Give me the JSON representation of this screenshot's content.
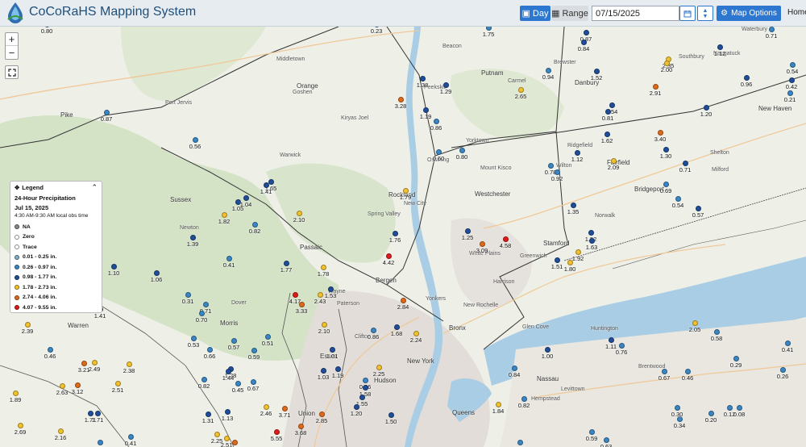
{
  "header": {
    "title": "CoCoRaHS Mapping System",
    "day_label": "Day",
    "range_label": "Range",
    "date_value": "07/15/2025",
    "map_options_label": "Map Options",
    "home_label": "Home"
  },
  "legend": {
    "heading": "Legend",
    "title": "24-Hour Precipitation",
    "date": "Jul 15, 2025",
    "obs_time": "4:30 AM-9:30 AM local obs time",
    "items": [
      {
        "label": "NA",
        "color": "#888888"
      },
      {
        "label": "Zero",
        "color": "#ffffff"
      },
      {
        "label": "Trace",
        "color": "#ffffff"
      },
      {
        "label": "0.01 - 0.25 in.",
        "color": "#7fb0c8"
      },
      {
        "label": "0.26 - 0.97 in.",
        "color": "#3b86c4"
      },
      {
        "label": "0.98 - 1.77 in.",
        "color": "#1f4e9a"
      },
      {
        "label": "1.78 - 2.73 in.",
        "color": "#f2c12e"
      },
      {
        "label": "2.74 - 4.06 in.",
        "color": "#e06a1b"
      },
      {
        "label": "4.07 - 9.55 in.",
        "color": "#e01a1a"
      }
    ]
  },
  "places": [
    {
      "n": "Middletown"
    },
    {
      "n": "Orange"
    },
    {
      "n": "Goshen"
    },
    {
      "n": "Kiryas Joel"
    },
    {
      "n": "Warwick"
    },
    {
      "n": "Sussex"
    },
    {
      "n": "Pike"
    },
    {
      "n": "Port Jervis"
    },
    {
      "n": "Rockland"
    },
    {
      "n": "New City"
    },
    {
      "n": "Spring Valley"
    },
    {
      "n": "Westchester"
    },
    {
      "n": "White Plains"
    },
    {
      "n": "New Rochelle"
    },
    {
      "n": "Yonkers"
    },
    {
      "n": "Bronx"
    },
    {
      "n": "New York"
    },
    {
      "n": "Bergen"
    },
    {
      "n": "Paterson"
    },
    {
      "n": "Passaic"
    },
    {
      "n": "Morris"
    },
    {
      "n": "Essex"
    },
    {
      "n": "Hudson"
    },
    {
      "n": "Warren"
    },
    {
      "n": "Union"
    },
    {
      "n": "Nassau"
    },
    {
      "n": "Queens"
    },
    {
      "n": "Putnam"
    },
    {
      "n": "Danbury"
    },
    {
      "n": "Fairfield"
    },
    {
      "n": "Bridgeport"
    },
    {
      "n": "Stamford"
    },
    {
      "n": "Norwalk"
    },
    {
      "n": "New Haven"
    },
    {
      "n": "Milford"
    },
    {
      "n": "Huntington"
    },
    {
      "n": "Brentwood"
    },
    {
      "n": "Hempstead"
    },
    {
      "n": "Levittown"
    },
    {
      "n": "Yorktown"
    },
    {
      "n": "Peekskill"
    },
    {
      "n": "Greenwich"
    },
    {
      "n": "Harrison"
    },
    {
      "n": "Glen Cove"
    },
    {
      "n": "Newburgh"
    },
    {
      "n": "Beacon"
    },
    {
      "n": "Carmel"
    },
    {
      "n": "Brewster"
    },
    {
      "n": "Ridgefield"
    },
    {
      "n": "Wilton"
    },
    {
      "n": "Mount Kisco"
    },
    {
      "n": "Clifton"
    },
    {
      "n": "Wayne"
    },
    {
      "n": "Dover"
    },
    {
      "n": "Newton"
    },
    {
      "n": "Shelton"
    },
    {
      "n": "Naugatuck"
    },
    {
      "n": "Waterbury"
    },
    {
      "n": "Southbury"
    },
    {
      "n": "Ossining"
    }
  ],
  "stations": [
    {
      "v": "0.80",
      "c": 4
    },
    {
      "v": "0.23",
      "c": 4
    },
    {
      "v": "1.75",
      "c": 4
    },
    {
      "v": "0.87",
      "c": 5
    },
    {
      "v": "0.84",
      "c": 5
    },
    {
      "v": "0.71",
      "c": 4
    },
    {
      "v": "1.12",
      "c": 5
    },
    {
      "v": "2.35",
      "c": 6
    },
    {
      "v": "2.00",
      "c": 6
    },
    {
      "v": "0.96",
      "c": 5
    },
    {
      "v": "0.54",
      "c": 4
    },
    {
      "v": "0.42",
      "c": 5
    },
    {
      "v": "0.21",
      "c": 4
    },
    {
      "v": "0.94",
      "c": 4
    },
    {
      "v": "1.52",
      "c": 5
    },
    {
      "v": "1.38",
      "c": 5
    },
    {
      "v": "1.29",
      "c": 5
    },
    {
      "v": "2.65",
      "c": 6
    },
    {
      "v": "2.91",
      "c": 7
    },
    {
      "v": "3.28",
      "c": 7
    },
    {
      "v": "1.19",
      "c": 5
    },
    {
      "v": "0.86",
      "c": 4
    },
    {
      "v": "0.87",
      "c": 4
    },
    {
      "v": "1.54",
      "c": 5
    },
    {
      "v": "0.81",
      "c": 5
    },
    {
      "v": "1.20",
      "c": 5
    },
    {
      "v": "1.62",
      "c": 5
    },
    {
      "v": "3.40",
      "c": 7
    },
    {
      "v": "1.30",
      "c": 5
    },
    {
      "v": "0.71",
      "c": 5
    },
    {
      "v": "0.56",
      "c": 4
    },
    {
      "v": "0.60",
      "c": 4
    },
    {
      "v": "0.80",
      "c": 4
    },
    {
      "v": "1.12",
      "c": 5
    },
    {
      "v": "2.09",
      "c": 6
    },
    {
      "v": "0.78",
      "c": 4
    },
    {
      "v": "0.92",
      "c": 4
    },
    {
      "v": "0.69",
      "c": 4
    },
    {
      "v": "0.54",
      "c": 4
    },
    {
      "v": "0.57",
      "c": 5
    },
    {
      "v": "1.65",
      "c": 5
    },
    {
      "v": "1.41",
      "c": 5
    },
    {
      "v": "1.79",
      "c": 6
    },
    {
      "v": "1.35",
      "c": 5
    },
    {
      "v": "1.05",
      "c": 5
    },
    {
      "v": "1.04",
      "c": 5
    },
    {
      "v": "2.10",
      "c": 6
    },
    {
      "v": "1.82",
      "c": 6
    },
    {
      "v": "0.82",
      "c": 4
    },
    {
      "v": "1.39",
      "c": 5
    },
    {
      "v": "1.76",
      "c": 5
    },
    {
      "v": "1.25",
      "c": 5
    },
    {
      "v": "4.58",
      "c": 8
    },
    {
      "v": "3.09",
      "c": 7
    },
    {
      "v": "1.52",
      "c": 5
    },
    {
      "v": "1.63",
      "c": 5
    },
    {
      "v": "1.92",
      "c": 6
    },
    {
      "v": "1.51",
      "c": 5
    },
    {
      "v": "1.80",
      "c": 6
    },
    {
      "v": "0.41",
      "c": 4
    },
    {
      "v": "1.77",
      "c": 5
    },
    {
      "v": "4.42",
      "c": 8
    },
    {
      "v": "1.78",
      "c": 6
    },
    {
      "v": "1.10",
      "c": 5
    },
    {
      "v": "1.06",
      "c": 5
    },
    {
      "v": "1.53",
      "c": 5
    },
    {
      "v": "0.31",
      "c": 4
    },
    {
      "v": "0.71",
      "c": 4
    },
    {
      "v": "4.17",
      "c": 8
    },
    {
      "v": "3.33",
      "c": 7
    },
    {
      "v": "2.43",
      "c": 6
    },
    {
      "v": "2.84",
      "c": 7
    },
    {
      "v": "1.41",
      "c": 5
    },
    {
      "v": "0.70",
      "c": 4
    },
    {
      "v": "2.39",
      "c": 6
    },
    {
      "v": "2.10",
      "c": 6
    },
    {
      "v": "0.86",
      "c": 4
    },
    {
      "v": "1.68",
      "c": 5
    },
    {
      "v": "2.24",
      "c": 6
    },
    {
      "v": "2.05",
      "c": 6
    },
    {
      "v": "0.58",
      "c": 4
    },
    {
      "v": "0.53",
      "c": 4
    },
    {
      "v": "0.57",
      "c": 4
    },
    {
      "v": "0.51",
      "c": 4
    },
    {
      "v": "0.66",
      "c": 4
    },
    {
      "v": "0.59",
      "c": 4
    },
    {
      "v": "1.01",
      "c": 5
    },
    {
      "v": "0.46",
      "c": 4
    },
    {
      "v": "1.11",
      "c": 5
    },
    {
      "v": "0.76",
      "c": 4
    },
    {
      "v": "1.00",
      "c": 5
    },
    {
      "v": "0.29",
      "c": 4
    },
    {
      "v": "0.41",
      "c": 4
    },
    {
      "v": "3.21",
      "c": 7
    },
    {
      "v": "2.49",
      "c": 6
    },
    {
      "v": "2.38",
      "c": 6
    },
    {
      "v": "1.28",
      "c": 5
    },
    {
      "v": "1.03",
      "c": 5
    },
    {
      "v": "1.19",
      "c": 5
    },
    {
      "v": "2.25",
      "c": 6
    },
    {
      "v": "0.84",
      "c": 4
    },
    {
      "v": "0.67",
      "c": 4
    },
    {
      "v": "0.46",
      "c": 4
    },
    {
      "v": "0.26",
      "c": 4
    },
    {
      "v": "2.63",
      "c": 6
    },
    {
      "v": "3.12",
      "c": 7
    },
    {
      "v": "2.51",
      "c": 6
    },
    {
      "v": "0.82",
      "c": 4
    },
    {
      "v": "1.44",
      "c": 5
    },
    {
      "v": "0.45",
      "c": 4
    },
    {
      "v": "0.67",
      "c": 4
    },
    {
      "v": "0.86",
      "c": 4
    },
    {
      "v": "1.58",
      "c": 5
    },
    {
      "v": "1.55",
      "c": 5
    },
    {
      "v": "0.82",
      "c": 4
    },
    {
      "v": "1.89",
      "c": 6
    },
    {
      "v": "1.71",
      "c": 5
    },
    {
      "v": "1.71",
      "c": 5
    },
    {
      "v": "1.31",
      "c": 5
    },
    {
      "v": "1.13",
      "c": 5
    },
    {
      "v": "2.46",
      "c": 6
    },
    {
      "v": "3.71",
      "c": 7
    },
    {
      "v": "2.85",
      "c": 7
    },
    {
      "v": "1.20",
      "c": 5
    },
    {
      "v": "1.50",
      "c": 5
    },
    {
      "v": "1.84",
      "c": 6
    },
    {
      "v": "0.34",
      "c": 4
    },
    {
      "v": "0.30",
      "c": 4
    },
    {
      "v": "0.20",
      "c": 4
    },
    {
      "v": "0.12",
      "c": 4
    },
    {
      "v": "0.08",
      "c": 4
    },
    {
      "v": "2.69",
      "c": 6
    },
    {
      "v": "2.16",
      "c": 6
    },
    {
      "v": "0.37",
      "c": 4
    },
    {
      "v": "0.41",
      "c": 4
    },
    {
      "v": "2.25",
      "c": 6
    },
    {
      "v": "2.51",
      "c": 6
    },
    {
      "v": "2.84",
      "c": 7
    },
    {
      "v": "5.55",
      "c": 8
    },
    {
      "v": "3.68",
      "c": 7
    },
    {
      "v": "0.59",
      "c": 4
    },
    {
      "v": "0.63",
      "c": 4
    },
    {
      "v": "0.88",
      "c": 4
    }
  ],
  "colors": {
    "map_bg": "#eef0e8",
    "water": "#a9cde4",
    "forest": "#d4e2c6",
    "urban": "#dfdcd8",
    "header_bg": "#e7ecf1",
    "accent": "#2d77d0"
  }
}
